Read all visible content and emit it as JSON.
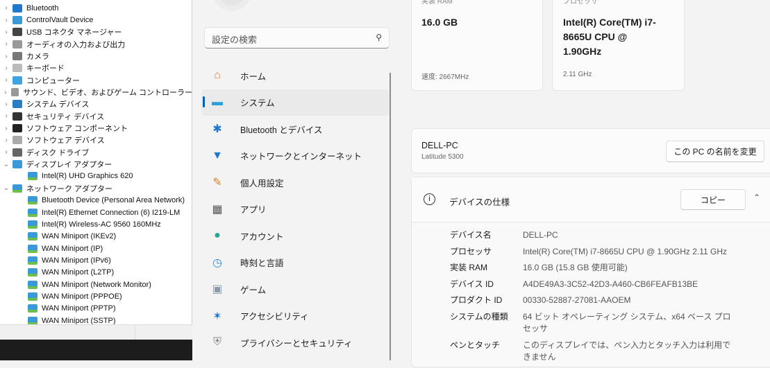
{
  "device_manager": {
    "categories": [
      {
        "label": "Bluetooth",
        "icon": "bluetooth-icon",
        "expanded": false
      },
      {
        "label": "ControlVault Device",
        "icon": "monitor-icon",
        "expanded": false
      },
      {
        "label": "USB コネクタ マネージャー",
        "icon": "usb-icon",
        "expanded": false
      },
      {
        "label": "オーディオの入力および出力",
        "icon": "speaker-icon",
        "expanded": false
      },
      {
        "label": "カメラ",
        "icon": "camera-icon",
        "expanded": false
      },
      {
        "label": "キーボード",
        "icon": "keyboard-icon",
        "expanded": false
      },
      {
        "label": "コンピューター",
        "icon": "computer-icon",
        "expanded": false
      },
      {
        "label": "サウンド、ビデオ、およびゲーム コントローラー",
        "icon": "speaker-icon",
        "expanded": false
      },
      {
        "label": "システム デバイス",
        "icon": "folder-icon",
        "expanded": false
      },
      {
        "label": "セキュリティ デバイス",
        "icon": "security-key-icon",
        "expanded": false
      },
      {
        "label": "ソフトウェア コンポーネント",
        "icon": "component-icon",
        "expanded": false
      },
      {
        "label": "ソフトウェア デバイス",
        "icon": "device-icon",
        "expanded": false
      },
      {
        "label": "ディスク ドライブ",
        "icon": "disk-icon",
        "expanded": false
      },
      {
        "label": "ディスプレイ アダプター",
        "icon": "display-adapter-icon",
        "expanded": true,
        "children": [
          "Intel(R) UHD Graphics 620"
        ]
      },
      {
        "label": "ネットワーク アダプター",
        "icon": "network-icon",
        "expanded": true,
        "children": [
          "Bluetooth Device (Personal Area Network)",
          "Intel(R) Ethernet Connection (6) I219-LM",
          "Intel(R) Wireless-AC 9560 160MHz",
          "WAN Miniport (IKEv2)",
          "WAN Miniport (IP)",
          "WAN Miniport (IPv6)",
          "WAN Miniport (L2TP)",
          "WAN Miniport (Network Monitor)",
          "WAN Miniport (PPPOE)",
          "WAN Miniport (PPTP)",
          "WAN Miniport (SSTP)"
        ]
      }
    ]
  },
  "settings": {
    "search_placeholder": "設定の検索",
    "nav": [
      {
        "label": "ホーム",
        "icon": "home-icon",
        "selected": false
      },
      {
        "label": "システム",
        "icon": "system-icon",
        "selected": true
      },
      {
        "label": "Bluetooth とデバイス",
        "icon": "bluetooth-icon",
        "selected": false
      },
      {
        "label": "ネットワークとインターネット",
        "icon": "wifi-icon",
        "selected": false
      },
      {
        "label": "個人用設定",
        "icon": "brush-icon",
        "selected": false
      },
      {
        "label": "アプリ",
        "icon": "apps-icon",
        "selected": false
      },
      {
        "label": "アカウント",
        "icon": "account-icon",
        "selected": false
      },
      {
        "label": "時刻と言語",
        "icon": "time-language-icon",
        "selected": false
      },
      {
        "label": "ゲーム",
        "icon": "gamepad-icon",
        "selected": false
      },
      {
        "label": "アクセシビリティ",
        "icon": "accessibility-icon",
        "selected": false
      },
      {
        "label": "プライバシーとセキュリティ",
        "icon": "shield-icon",
        "selected": false
      }
    ],
    "ram_card": {
      "label": "実装 RAM",
      "value": "16.0 GB",
      "sub": "速度: 2667MHz"
    },
    "cpu_card": {
      "label": "プロセッサ",
      "value": "Intel(R) Core(TM) i7-8665U CPU @ 1.90GHz",
      "sub": "2.11 GHz"
    },
    "device_card": {
      "name": "DELL-PC",
      "model": "Latitude 5300",
      "rename_button": "この PC の名前を変更"
    },
    "specs": {
      "title": "デバイスの仕様",
      "copy_button": "コピー",
      "rows": [
        {
          "key": "デバイス名",
          "value": "DELL-PC"
        },
        {
          "key": "プロセッサ",
          "value": "Intel(R) Core(TM) i7-8665U CPU @ 1.90GHz   2.11 GHz"
        },
        {
          "key": "実装 RAM",
          "value": "16.0 GB (15.8 GB 使用可能)"
        },
        {
          "key": "デバイス ID",
          "value": "A4DE49A3-3C52-42D3-A460-CB6FEAFB13BE"
        },
        {
          "key": "プロダクト ID",
          "value": "00330-52887-27081-AAOEM"
        },
        {
          "key": "システムの種類",
          "value": "64 ビット オペレーティング システム、x64 ベース プロセッサ"
        },
        {
          "key": "ペンとタッチ",
          "value": "このディスプレイでは、ペン入力とタッチ入力は利用できません"
        }
      ]
    }
  }
}
